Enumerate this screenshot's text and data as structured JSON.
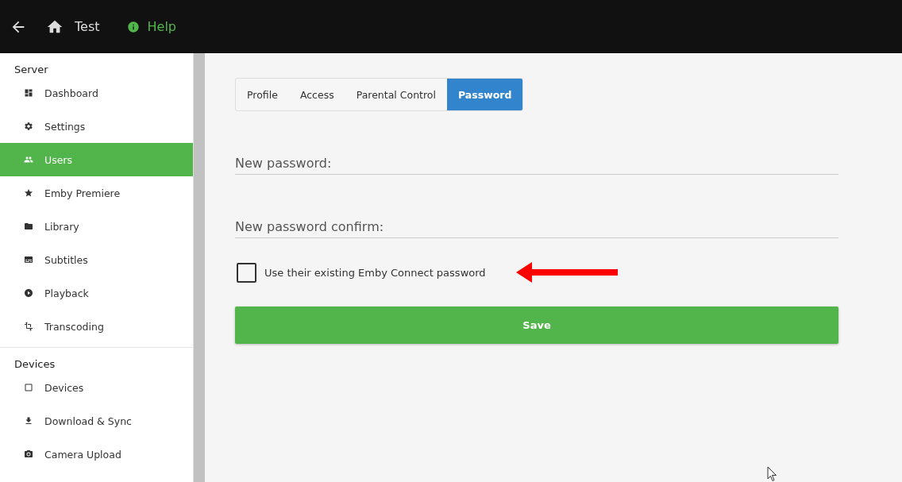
{
  "header": {
    "title": "Test",
    "help": "Help"
  },
  "sidebar": {
    "sections": [
      {
        "title": "Server",
        "items": [
          {
            "label": "Dashboard",
            "selected": false
          },
          {
            "label": "Settings",
            "selected": false
          },
          {
            "label": "Users",
            "selected": true
          },
          {
            "label": "Emby Premiere",
            "selected": false
          },
          {
            "label": "Library",
            "selected": false
          },
          {
            "label": "Subtitles",
            "selected": false
          },
          {
            "label": "Playback",
            "selected": false
          },
          {
            "label": "Transcoding",
            "selected": false
          }
        ]
      },
      {
        "title": "Devices",
        "items": [
          {
            "label": "Devices",
            "selected": false
          },
          {
            "label": "Download & Sync",
            "selected": false
          },
          {
            "label": "Camera Upload",
            "selected": false
          }
        ]
      }
    ]
  },
  "tabs": [
    {
      "label": "Profile",
      "selected": false
    },
    {
      "label": "Access",
      "selected": false
    },
    {
      "label": "Parental Control",
      "selected": false
    },
    {
      "label": "Password",
      "selected": true
    }
  ],
  "fields": [
    {
      "label": "New password:"
    },
    {
      "label": "New password confirm:"
    }
  ],
  "checkbox": {
    "label": "Use their existing Emby Connect password",
    "checked": false
  },
  "save_button": "Save"
}
